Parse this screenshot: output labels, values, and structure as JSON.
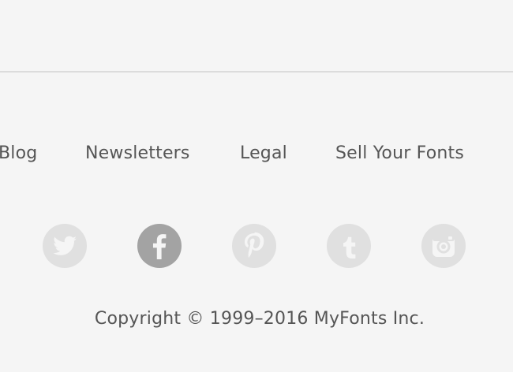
{
  "footer": {
    "nav": [
      {
        "label": "Blog"
      },
      {
        "label": "Newsletters"
      },
      {
        "label": "Legal"
      },
      {
        "label": "Sell Your Fonts"
      }
    ],
    "social": [
      {
        "icon": "twitter-icon",
        "color": "#e0e0e0"
      },
      {
        "icon": "facebook-icon",
        "color": "#a3a3a3"
      },
      {
        "icon": "pinterest-icon",
        "color": "#e0e0e0"
      },
      {
        "icon": "tumblr-icon",
        "color": "#e0e0e0"
      },
      {
        "icon": "instagram-icon",
        "color": "#e0e0e0"
      }
    ],
    "copyright": "Copyright © 1999–2016 MyFonts Inc."
  }
}
